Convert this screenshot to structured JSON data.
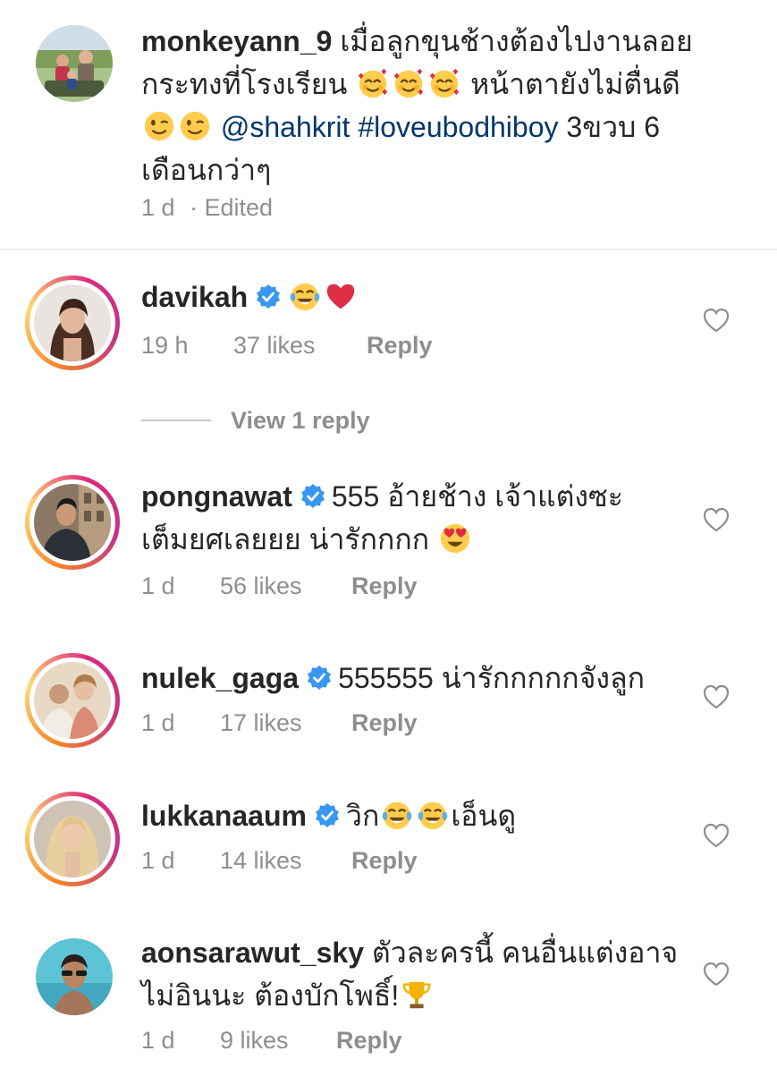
{
  "caption": {
    "username": "monkeyann_9",
    "text_line1": "เมื่อลูกขุนช้างต้องไปงานลอย",
    "text_line2a": "กระทงที่โรงเรียน",
    "text_line2b": "หน้าตายังไม่ตื่นดี",
    "mention": "@shahkrit",
    "hashtag": "#loveubodhiboy",
    "text_line3_tail": "3ขวบ 6",
    "text_line4": "เดือนกว่าๆ",
    "time": "1 d",
    "edited": "· Edited",
    "emoji_line2": [
      "smiling-face-with-hearts",
      "smiling-face-with-hearts",
      "smiling-face-with-hearts"
    ],
    "emoji_line3": [
      "winking-face",
      "winking-face"
    ]
  },
  "comments": [
    {
      "username": "davikah",
      "verified": true,
      "text": "",
      "emojis": [
        "face-with-tears-of-joy",
        "red-heart"
      ],
      "time": "19 h",
      "likes": "37 likes",
      "reply": "Reply",
      "story_ring": true
    },
    {
      "username": "pongnawat",
      "verified": true,
      "text_line1": "555 อ้ายช้าง เจ้าแต่งซะ",
      "text_line2": "เต็มยศเลยยย น่ารักกกก",
      "emojis": [
        "smiling-face-with-heart-eyes"
      ],
      "time": "1 d",
      "likes": "56 likes",
      "reply": "Reply",
      "story_ring": true
    },
    {
      "username": "nulek_gaga",
      "verified": true,
      "text": "555555 น่ารักกกกกจังลูก",
      "time": "1 d",
      "likes": "17 likes",
      "reply": "Reply",
      "story_ring": true
    },
    {
      "username": "lukkanaaum",
      "verified": true,
      "text_pre": "วิก",
      "text_post": "เอ็นดู",
      "emojis": [
        "face-with-tears-of-joy",
        "face-with-tears-of-joy"
      ],
      "time": "1 d",
      "likes": "14 likes",
      "reply": "Reply",
      "story_ring": true
    },
    {
      "username": "aonsarawut_sky",
      "verified": false,
      "text_line1": "ตัวละครนี้ คนอื่นแต่งอาจ",
      "text_line2": "ไม่อินนะ ต้องบักโพธิ์!",
      "emojis": [
        "trophy"
      ],
      "time": "1 d",
      "likes": "9 likes",
      "reply": "Reply",
      "story_ring": false
    }
  ],
  "view_replies": "View 1 reply",
  "colors": {
    "text": "#262626",
    "secondary": "#8e8e8e",
    "link": "#00376b",
    "verified_blue": "#3897f0",
    "divider": "#dbdbdb"
  }
}
